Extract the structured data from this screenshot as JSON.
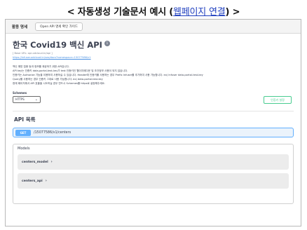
{
  "heading": {
    "prefix": "< 자동생성 기술문서 예시 (",
    "link": "웹페이지 연결",
    "suffix": ") >"
  },
  "tabs": [
    {
      "label": "활용 명세"
    },
    {
      "label": "Open API 명세 확인 가이드"
    }
  ],
  "api": {
    "title": "한국 Covid19 백신 API",
    "version_badge": "1",
    "base_url": "[ Base URL: api.odcloud.kr/api ]",
    "spec_link": "https://infuser.odcloud.kr/oas/docs?namespace=15077586/v1",
    "description_lines": [
      "백신 예방 접종 등과 정보를 제공하기 위한 API입니다.",
      "API key는 인증키 data-portal-test-key가 test 인증키인 웹이지에다운 및 조건정보 사용이 되지 않습니다.",
      "인증키는 Authorize 기능을 이용하여 사용하실 수 있습니다. Header에 인증키를 사용하는 경우 Prefix Infuser를 추가하여 사용 가능합니다. ex) Infuser data-portal-test-key",
      "Query를 사용하는 경우 인증키 그대로 사용 가능합니다. ex) data-portal-test-key",
      "현재 페이지에서 API 호출을 시도하실 경우 반드시 Schemes를 https로 설정해주세요."
    ]
  },
  "schemes": {
    "label": "Schemes",
    "selected": "HTTPS",
    "caret": "⌄"
  },
  "authorize_button": "인증키 설정",
  "tag": {
    "title": "API 목록",
    "operation": {
      "method": "GET",
      "path": "/15077586/v1/centers"
    }
  },
  "models": {
    "title": "Models",
    "items": [
      {
        "name": "centers_model",
        "chevron": "›"
      },
      {
        "name": "centers_api",
        "chevron": "›"
      }
    ]
  },
  "colors": {
    "get_method": "#61affe",
    "authorize_green": "#49cc90",
    "link_blue": "#4990e2"
  }
}
